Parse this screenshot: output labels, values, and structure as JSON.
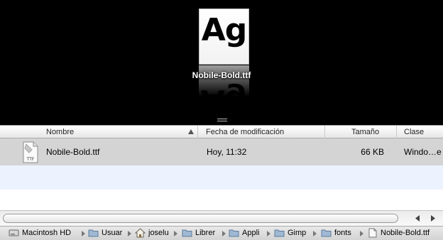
{
  "coverflow": {
    "preview_glyph": "Ag",
    "title": "Nobile-Bold.ttf"
  },
  "columns": {
    "name": "Nombre",
    "modified": "Fecha de modificación",
    "size": "Tamaño",
    "kind": "Clase"
  },
  "files": [
    {
      "name": "Nobile-Bold.ttf",
      "modified": "Hoy, 11:32",
      "size": "66 KB",
      "kind": "Windo…e",
      "icon": "ttf-font-file-icon",
      "icon_label": "TTF"
    }
  ],
  "pathbar": {
    "items": [
      {
        "label": "Macintosh HD",
        "icon": "hard-drive-icon"
      },
      {
        "label": "Usuar",
        "icon": "folder-icon"
      },
      {
        "label": "joselu",
        "icon": "home-icon"
      },
      {
        "label": "Librer",
        "icon": "folder-icon"
      },
      {
        "label": "Appli",
        "icon": "folder-icon"
      },
      {
        "label": "Gimp",
        "icon": "folder-icon"
      },
      {
        "label": "fonts",
        "icon": "folder-icon"
      },
      {
        "label": "Nobile-Bold.ttf",
        "icon": "document-icon"
      }
    ]
  },
  "colors": {
    "coverflow_bg": "#000000",
    "selected_row": "#d4d4d4",
    "alt_row": "#edf3fe"
  }
}
